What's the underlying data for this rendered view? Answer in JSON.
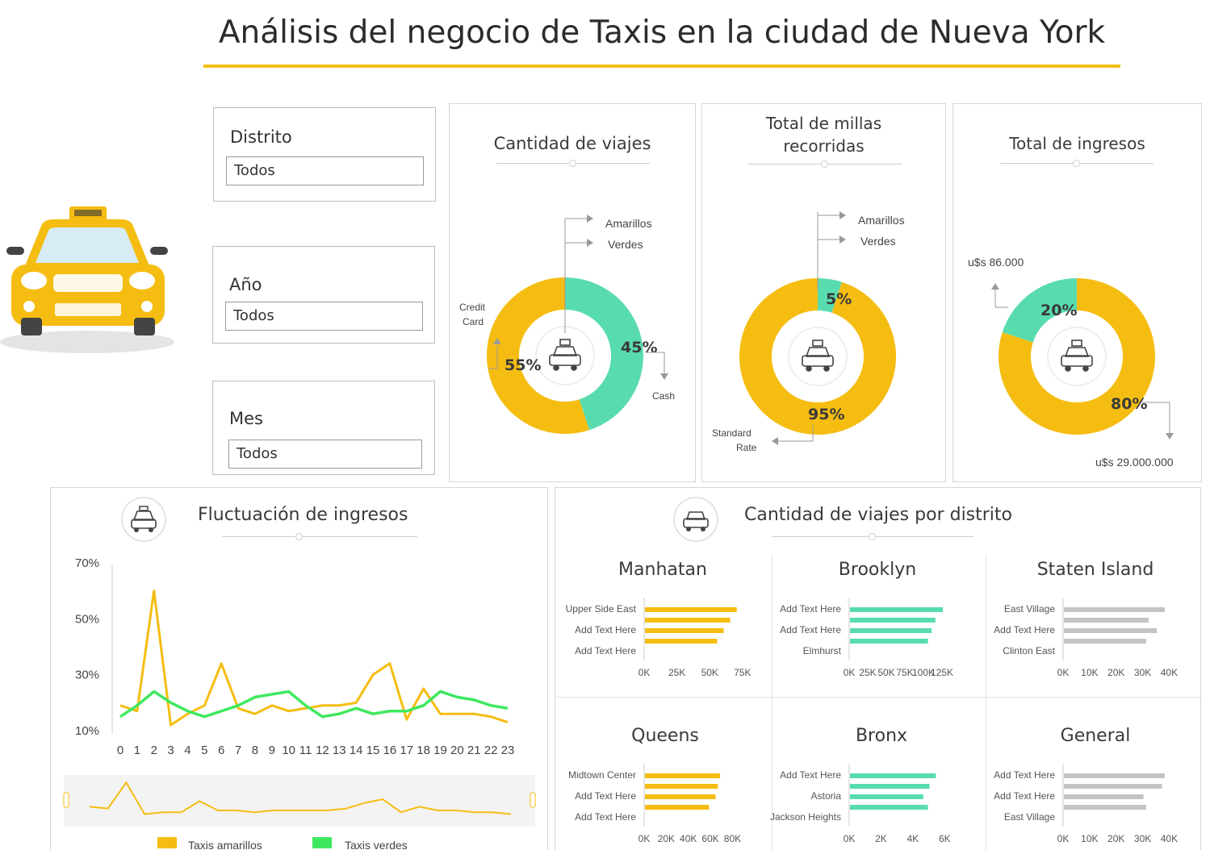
{
  "header": {
    "title": "Análisis del negocio de Taxis en la ciudad de Nueva York"
  },
  "filters": [
    {
      "label": "Distrito",
      "value": "Todos"
    },
    {
      "label": "Año",
      "value": "Todos"
    },
    {
      "label": "Mes",
      "value": "Todos"
    }
  ],
  "colors": {
    "yellow": "#f5bd12",
    "green": "#58dcae",
    "grey": "#c4c4c4",
    "green_line": "#3ee85e"
  },
  "legend": {
    "yellow": "Amarillos",
    "green": "Verdes"
  },
  "kpis": {
    "viajes": {
      "title": "Cantidad de viajes",
      "left_label_1": "Credit",
      "left_label_2": "Card",
      "right_label": "Cash"
    },
    "millas": {
      "title_1": "Total de millas",
      "title_2": "recorridas",
      "bottom_label_1": "Standard",
      "bottom_label_2": "Rate"
    },
    "ingresos": {
      "title": "Total de ingresos",
      "top_value": "u$s 86.000",
      "bottom_value": "u$s 29.000.000"
    }
  },
  "fluctuation": {
    "title": "Fluctuación de ingresos",
    "legend_yellow": "Taxis amarillos",
    "legend_green": "Taxis verdes"
  },
  "district": {
    "title": "Cantidad de viajes por distrito"
  },
  "chart_data": [
    {
      "type": "pie",
      "title": "Cantidad de viajes",
      "categories": [
        "Amarillos",
        "Verdes"
      ],
      "values": [
        55,
        45
      ],
      "labels": [
        "55%",
        "45%"
      ]
    },
    {
      "type": "pie",
      "title": "Total de millas recorridas",
      "categories": [
        "Amarillos",
        "Verdes"
      ],
      "values": [
        95,
        5
      ],
      "labels": [
        "95%",
        "5%"
      ]
    },
    {
      "type": "pie",
      "title": "Total de ingresos",
      "categories": [
        "Amarillos",
        "Verdes"
      ],
      "values": [
        80,
        20
      ],
      "labels": [
        "80%",
        "20%"
      ]
    },
    {
      "type": "line",
      "title": "Fluctuación de ingresos",
      "x": [
        "0",
        "1",
        "2",
        "3",
        "4",
        "5",
        "6",
        "7",
        "8",
        "9",
        "10",
        "11",
        "12",
        "13",
        "14",
        "15",
        "16",
        "17",
        "18",
        "19",
        "20",
        "21",
        "22",
        "23"
      ],
      "y_ticks": [
        "70%",
        "50%",
        "30%",
        "10%"
      ],
      "ylim": [
        10,
        70
      ],
      "series": [
        {
          "name": "Taxis amarillos",
          "values": [
            19,
            17,
            60,
            12,
            16,
            19,
            34,
            18,
            16,
            19,
            17,
            18,
            19,
            19,
            20,
            30,
            34,
            14,
            25,
            16,
            16,
            16,
            15,
            13
          ]
        },
        {
          "name": "Taxis verdes",
          "values": [
            15,
            19,
            24,
            20,
            17,
            15,
            17,
            19,
            22,
            23,
            24,
            19,
            15,
            16,
            18,
            16,
            17,
            17,
            19,
            24,
            22,
            21,
            19,
            18
          ]
        }
      ],
      "navigator": [
        9,
        8,
        22,
        5,
        6,
        6,
        12,
        7,
        7,
        6,
        7,
        7,
        7,
        7,
        8,
        11,
        13,
        6,
        9,
        7,
        7,
        6,
        6,
        5
      ]
    },
    {
      "type": "bar",
      "title": "Manhatan",
      "categories": [
        "Upper Side East",
        "Add Text Here",
        "Add Text Here",
        ""
      ],
      "values": [
        70,
        65,
        60,
        55
      ],
      "ticks": [
        "0K",
        "25K",
        "50K",
        "75K"
      ],
      "xlim": [
        0,
        80
      ]
    },
    {
      "type": "bar",
      "title": "Brooklyn",
      "categories": [
        "Add Text Here",
        "Add Text Here",
        "Elmhurst",
        ""
      ],
      "values": [
        125,
        115,
        110,
        105
      ],
      "ticks": [
        "0K",
        "25K",
        "50K",
        "75K",
        "100K",
        "125K"
      ],
      "xlim": [
        0,
        150
      ]
    },
    {
      "type": "bar",
      "title": "Staten Island",
      "categories": [
        "East Village",
        "Add Text Here",
        "Clinton East",
        ""
      ],
      "values": [
        38,
        32,
        35,
        31
      ],
      "ticks": [
        "0K",
        "10K",
        "20K",
        "30K",
        "40K"
      ],
      "xlim": [
        0,
        42
      ]
    },
    {
      "type": "bar",
      "title": "Queens",
      "categories": [
        "Midtown Center",
        "Add Text Here",
        "Add Text Here",
        ""
      ],
      "values": [
        68,
        66,
        64,
        58
      ],
      "ticks": [
        "0K",
        "20K",
        "40K",
        "60K",
        "80K"
      ],
      "xlim": [
        0,
        95
      ]
    },
    {
      "type": "bar",
      "title": "Bronx",
      "categories": [
        "Add Text Here",
        "Astoria",
        "Jackson Heights",
        ""
      ],
      "values": [
        5.4,
        5.0,
        4.6,
        4.9
      ],
      "ticks": [
        "0K",
        "2K",
        "4K",
        "6K"
      ],
      "xlim": [
        0,
        7
      ]
    },
    {
      "type": "bar",
      "title": "General",
      "categories": [
        "Add Text Here",
        "Add Text Here",
        "East Village",
        ""
      ],
      "values": [
        38,
        37,
        30,
        31
      ],
      "ticks": [
        "0K",
        "10K",
        "20K",
        "30K",
        "40K"
      ],
      "xlim": [
        0,
        42
      ]
    }
  ]
}
